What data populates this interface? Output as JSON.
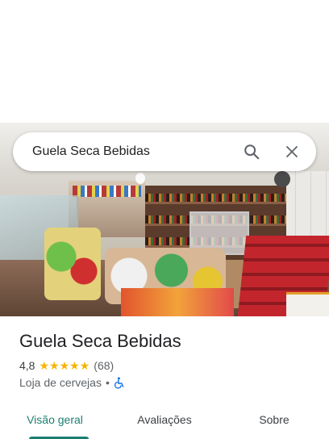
{
  "search": {
    "query": "Guela Seca Bebidas"
  },
  "icons": {
    "search": "search-icon",
    "close": "close-icon",
    "star": "star-icon",
    "accessibility": "wheelchair-accessible-icon"
  },
  "place": {
    "name": "Guela Seca Bebidas",
    "rating": "4,8",
    "stars": 5,
    "review_count": "(68)",
    "category": "Loja de cervejas",
    "separator": "•"
  },
  "tabs": [
    {
      "label": "Visão geral",
      "active": true
    },
    {
      "label": "Avaliações",
      "active": false
    },
    {
      "label": "Sobre",
      "active": false
    }
  ],
  "colors": {
    "accent": "#1a7f70",
    "star": "#f6b400",
    "accessibility": "#1a73e8"
  }
}
